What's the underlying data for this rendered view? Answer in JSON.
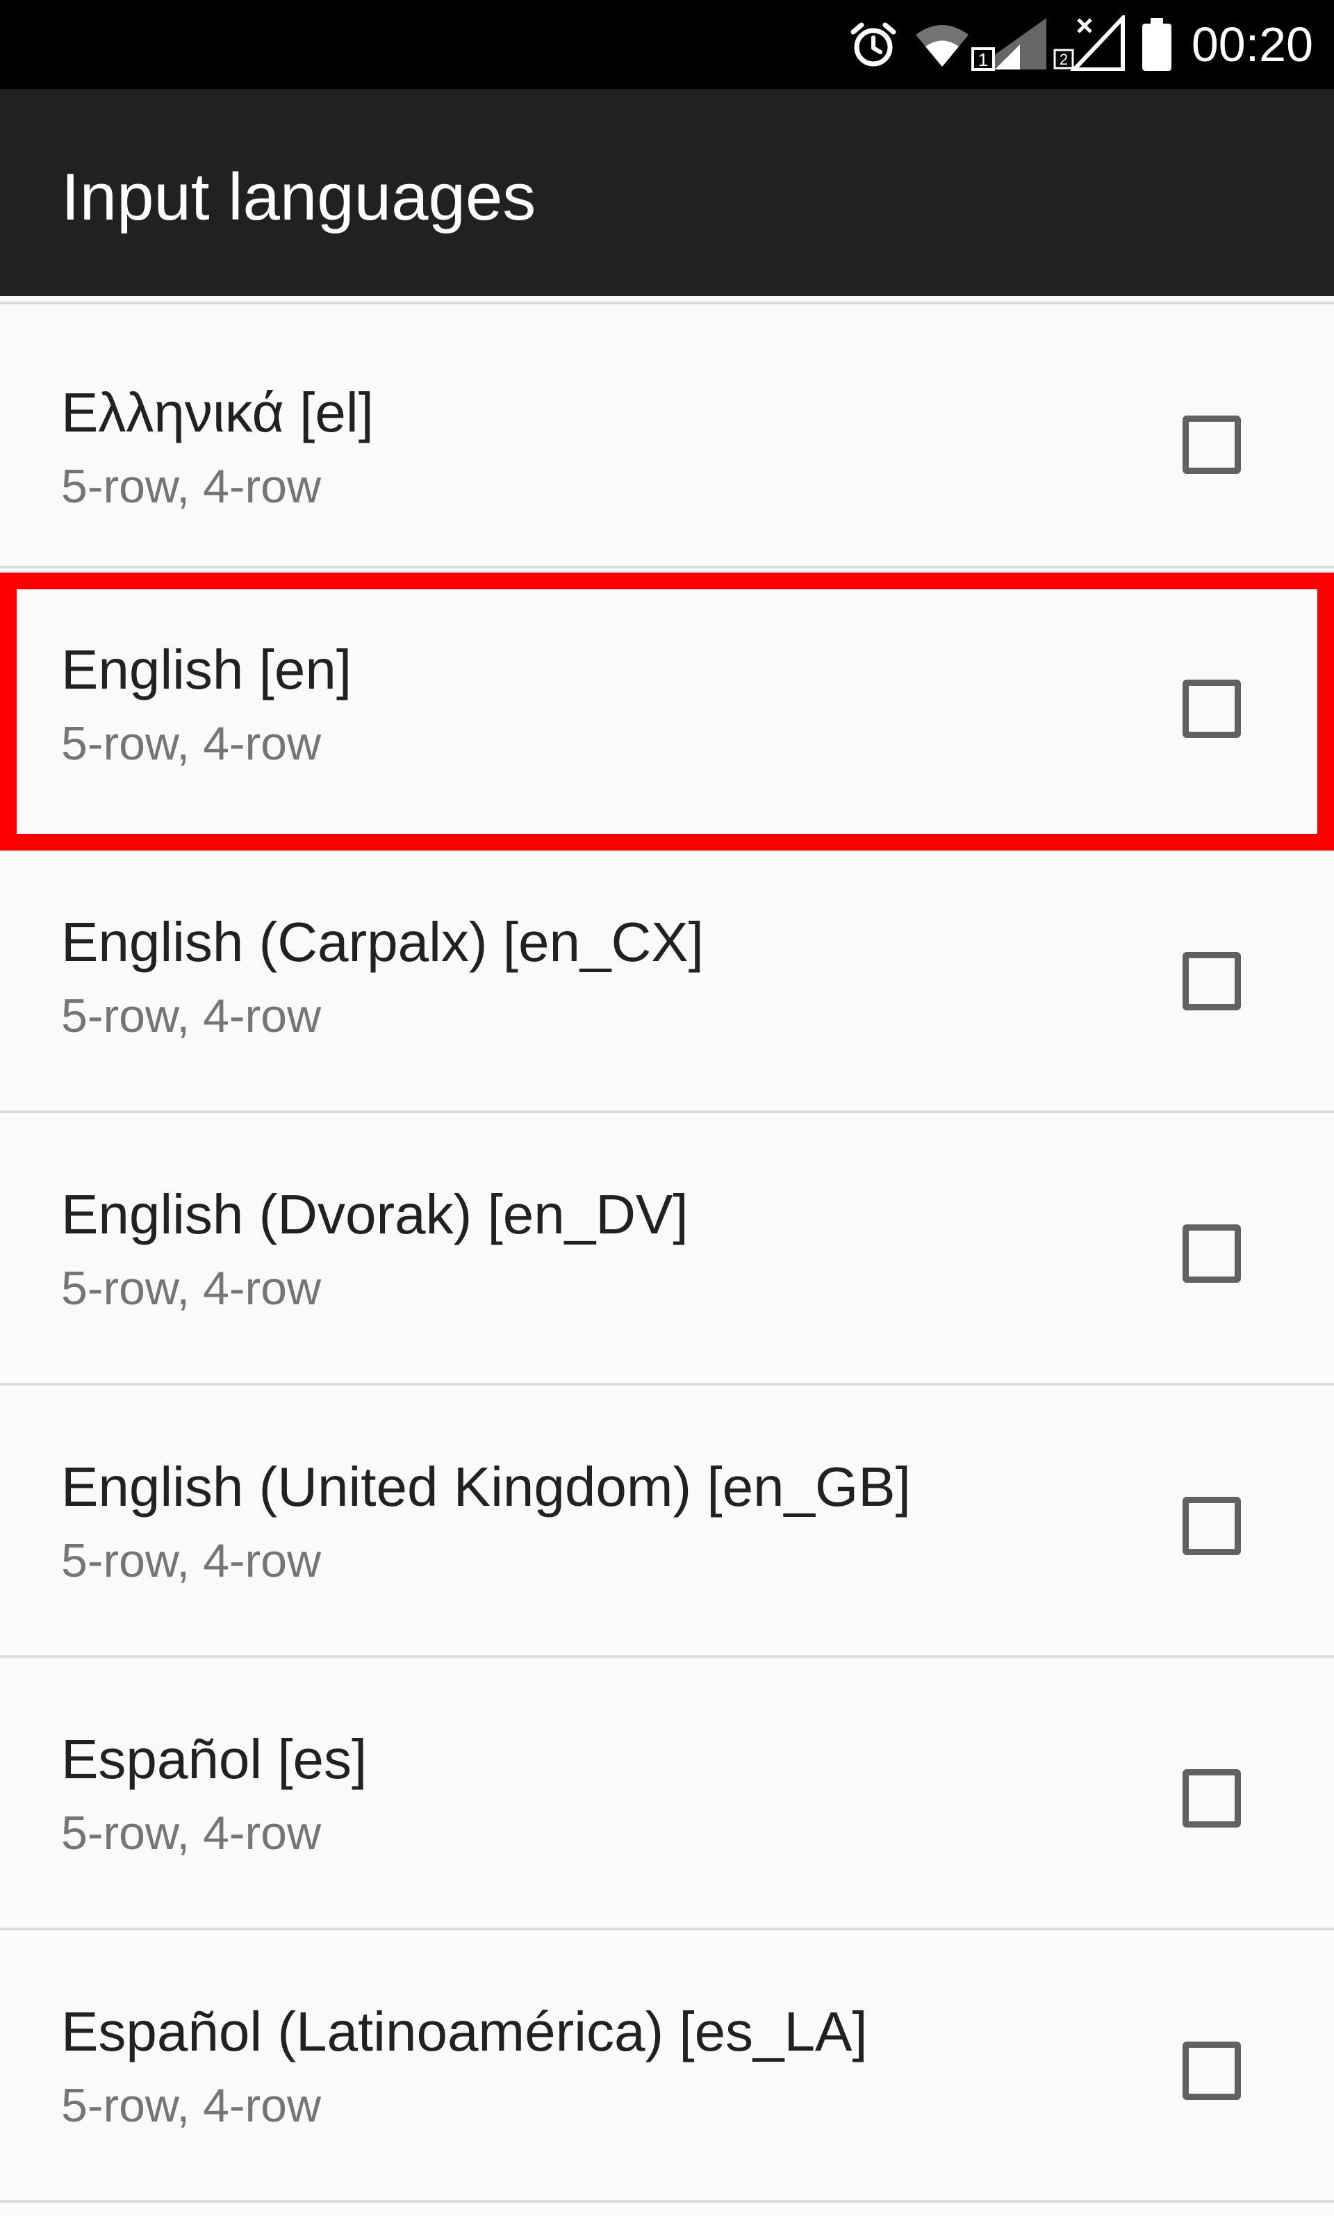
{
  "status_bar": {
    "time": "00:20",
    "icons": [
      "alarm-icon",
      "wifi-icon",
      "sim1-signal-icon",
      "sim2-signal-no-service-icon",
      "battery-icon"
    ],
    "background": "#000000",
    "foreground": "#ffffff"
  },
  "app_bar": {
    "title": "Input languages",
    "background": "#212121"
  },
  "list": {
    "items": [
      {
        "title": "Ελληνικά [el]",
        "summary": "5-row, 4-row",
        "checked": false
      },
      {
        "title": "English [en]",
        "summary": "5-row, 4-row",
        "checked": false,
        "highlighted": true
      },
      {
        "title": "English (Carpalx) [en_CX]",
        "summary": "5-row, 4-row",
        "checked": false
      },
      {
        "title": "English (Dvorak) [en_DV]",
        "summary": "5-row, 4-row",
        "checked": false
      },
      {
        "title": "English (United Kingdom) [en_GB]",
        "summary": "5-row, 4-row",
        "checked": false
      },
      {
        "title": "Español [es]",
        "summary": "5-row, 4-row",
        "checked": false
      },
      {
        "title": "Español (Latinoamérica) [es_LA]",
        "summary": "5-row, 4-row",
        "checked": false
      }
    ]
  },
  "colors": {
    "list_background": "#fafafa",
    "title_text": "#212121",
    "summary_text": "#757575",
    "highlight": "#ff0000"
  }
}
